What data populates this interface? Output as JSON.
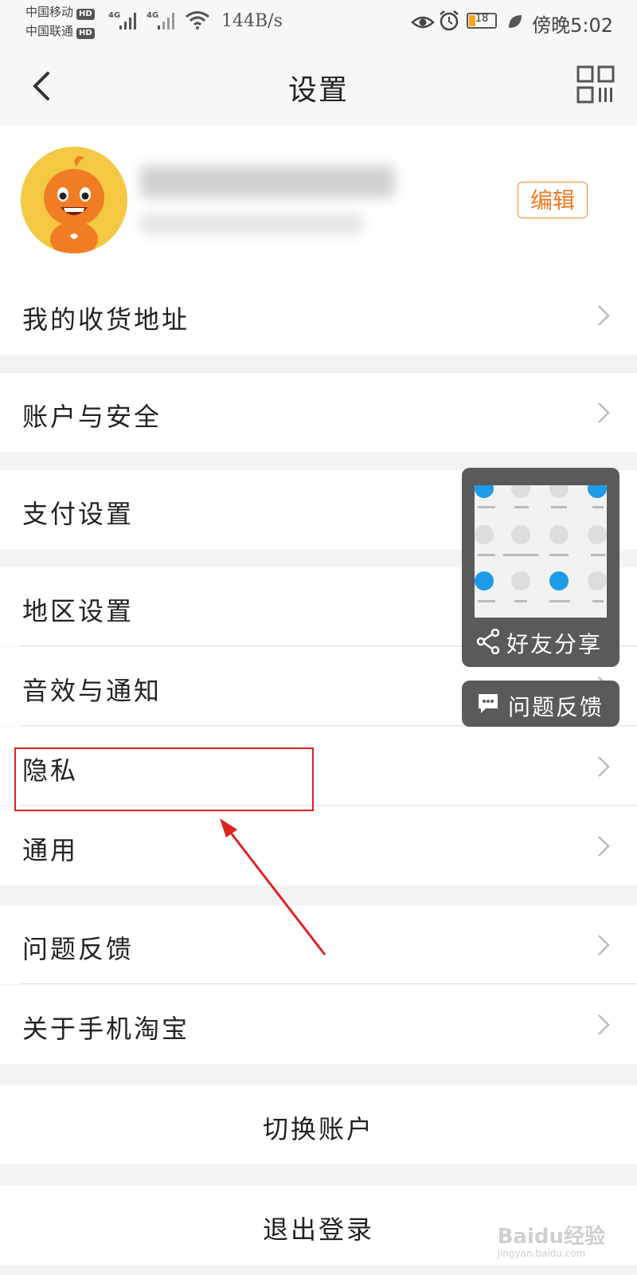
{
  "status_bar": {
    "carrier1": "中国移动",
    "carrier2": "中国联通",
    "hd_badge": "HD",
    "net_type": "4G",
    "net_speed": "144B/s",
    "battery": "18",
    "time": "傍晚5:02"
  },
  "nav": {
    "title": "设置"
  },
  "profile": {
    "edit_label": "编辑"
  },
  "menu": {
    "address": "我的收货地址",
    "account_security": "账户与安全",
    "payment": "支付设置",
    "region": "地区设置",
    "sound_notify": "音效与通知",
    "privacy": "隐私",
    "general": "通用",
    "feedback": "问题反馈",
    "about": "关于手机淘宝"
  },
  "actions": {
    "switch_account": "切换账户",
    "logout": "退出登录"
  },
  "floating": {
    "share_label": "好友分享",
    "feedback_label": "问题反馈"
  },
  "colors": {
    "accent": "#ef7a1e",
    "annotation": "#dd2222",
    "float_bg": "#5a5a5a"
  },
  "watermark": "Baidu经验"
}
